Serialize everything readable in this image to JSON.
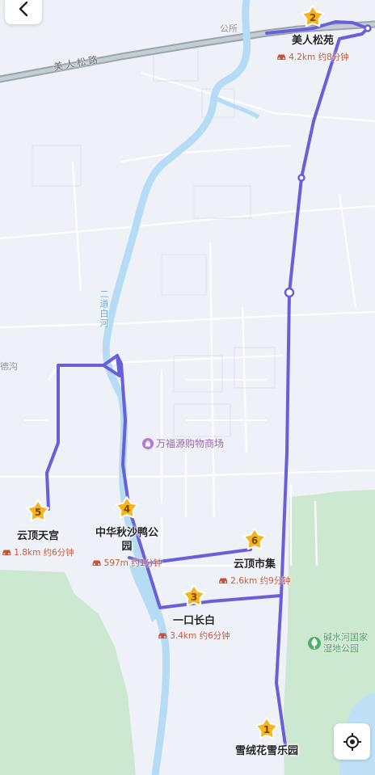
{
  "stops": [
    {
      "num": "1",
      "name": "雪绒花雪乐园",
      "info": ""
    },
    {
      "num": "2",
      "name": "美人松苑",
      "info": "4.2km 约8分钟"
    },
    {
      "num": "3",
      "name": "一口长白",
      "info": "3.4km 约6分钟"
    },
    {
      "num": "4",
      "name": "中华秋沙鸭公",
      "name2": "园",
      "info": "597m 约1分钟"
    },
    {
      "num": "5",
      "name": "云顶天宫",
      "info": "1.8km 约6分钟"
    },
    {
      "num": "6",
      "name": "云顶市集",
      "info": "2.6km 约9分钟"
    }
  ],
  "map_labels": {
    "road_meirensong": "美人松路",
    "place_gongsuo": "公所",
    "river": "二道白河",
    "place_left": "德沟",
    "mall": "万福源购物商场",
    "park_line1": "碱水河国家",
    "park_line2": "湿地公园"
  },
  "icons": {
    "back": "back-arrow-icon",
    "locate": "locate-icon",
    "car": "car-icon",
    "star": "star-marker-icon"
  },
  "colors": {
    "route": "#6a5fd8",
    "marker": "#f6b51c",
    "info": "#c5523a",
    "water": "#b8dcf6",
    "park": "#cbe8cf"
  }
}
